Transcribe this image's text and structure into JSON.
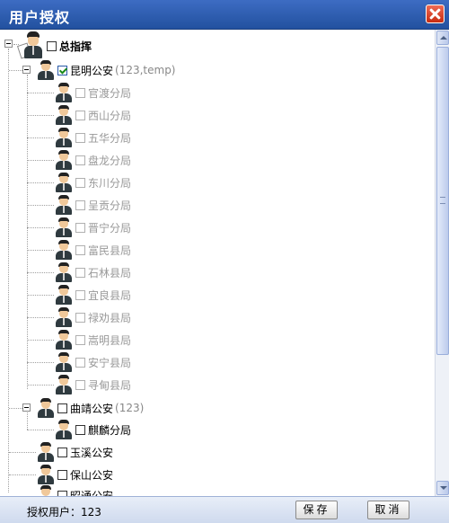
{
  "window": {
    "title": "用户授权"
  },
  "tree": {
    "root": {
      "label": "总指挥",
      "checked": false
    },
    "groups": [
      {
        "label": "昆明公安",
        "count": "(123,temp)",
        "checked": true,
        "expanded": true,
        "children": [
          "官渡分局",
          "西山分局",
          "五华分局",
          "盘龙分局",
          "东川分局",
          "呈贡分局",
          "晋宁分局",
          "富民县局",
          "石林县局",
          "宜良县局",
          "禄劝县局",
          "嵩明县局",
          "安宁县局",
          "寻甸县局"
        ]
      },
      {
        "label": "曲靖公安",
        "count": "(123)",
        "checked": false,
        "expanded": true,
        "children": [
          "麒麟分局"
        ]
      },
      {
        "label": "玉溪公安",
        "count": "",
        "checked": false,
        "expanded": false,
        "children": []
      },
      {
        "label": "保山公安",
        "count": "",
        "checked": false,
        "expanded": false,
        "children": []
      },
      {
        "label": "昭通公安",
        "count": "",
        "checked": false,
        "expanded": false,
        "children": []
      }
    ]
  },
  "footer": {
    "info": "授权用户：123",
    "save_label": "保存",
    "cancel_label": "取消"
  }
}
